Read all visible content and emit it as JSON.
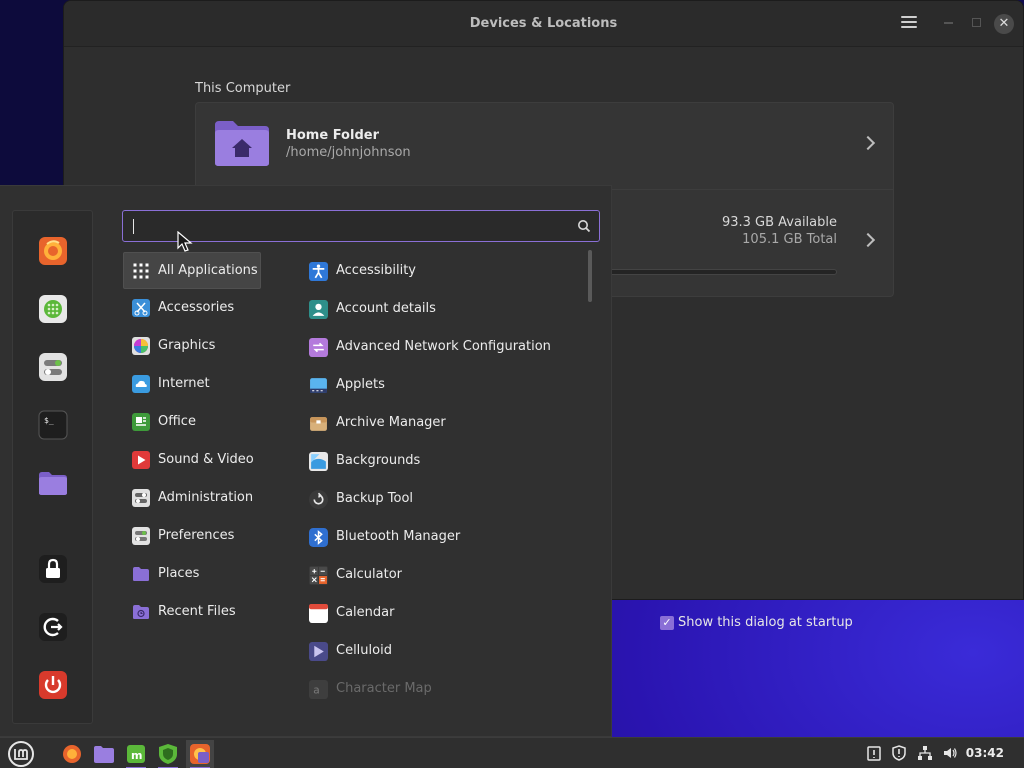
{
  "window": {
    "title": "Devices & Locations",
    "section_title": "This Computer",
    "home": {
      "name": "Home Folder",
      "path": "/home/johnjohnson"
    },
    "disk": {
      "available": "93.3 GB Available",
      "total": "105.1 GB Total"
    },
    "startup_checkbox": {
      "label": "Show this dialog at startup",
      "checked": true
    }
  },
  "menu": {
    "search": {
      "value": "",
      "placeholder": ""
    },
    "favorites": [
      {
        "name": "firefox-icon"
      },
      {
        "name": "software-manager-icon"
      },
      {
        "name": "settings-icon"
      },
      {
        "name": "terminal-icon"
      },
      {
        "name": "files-icon"
      },
      {
        "name": "lock-icon"
      },
      {
        "name": "logout-icon"
      },
      {
        "name": "power-icon"
      }
    ],
    "categories": [
      {
        "label": "All Applications",
        "icon": "grid-icon",
        "color": "#ffffff"
      },
      {
        "label": "Accessories",
        "icon": "scissors-icon",
        "color": "#3a8fd8"
      },
      {
        "label": "Graphics",
        "icon": "color-wheel-icon",
        "color": "#c43bd6"
      },
      {
        "label": "Internet",
        "icon": "cloud-icon",
        "color": "#3a9be0"
      },
      {
        "label": "Office",
        "icon": "document-icon",
        "color": "#3e9a3a"
      },
      {
        "label": "Sound & Video",
        "icon": "play-icon",
        "color": "#e03a3a"
      },
      {
        "label": "Administration",
        "icon": "toggles-icon",
        "color": "#cfcfcf"
      },
      {
        "label": "Preferences",
        "icon": "settings-icon",
        "color": "#d8d8d8"
      },
      {
        "label": "Places",
        "icon": "folder-icon",
        "color": "#8a6fd6"
      },
      {
        "label": "Recent Files",
        "icon": "recent-folder-icon",
        "color": "#8a6fd6"
      }
    ],
    "apps": [
      {
        "label": "Accessibility",
        "icon": "accessibility-icon",
        "color": "#2f78d8"
      },
      {
        "label": "Account details",
        "icon": "account-icon",
        "color": "#2e8f8a"
      },
      {
        "label": "Advanced Network Configuration",
        "icon": "network-icon",
        "color": "#b47adc"
      },
      {
        "label": "Applets",
        "icon": "applets-icon",
        "color": "#5ab4ef"
      },
      {
        "label": "Archive Manager",
        "icon": "archive-icon",
        "color": "#d8b07a"
      },
      {
        "label": "Backgrounds",
        "icon": "backgrounds-icon",
        "color": "#3a9be0"
      },
      {
        "label": "Backup Tool",
        "icon": "backup-icon",
        "color": "#3a3a3a"
      },
      {
        "label": "Bluetooth Manager",
        "icon": "bluetooth-icon",
        "color": "#2f6fd0"
      },
      {
        "label": "Calculator",
        "icon": "calculator-icon",
        "color": "#5a5a5a"
      },
      {
        "label": "Calendar",
        "icon": "calendar-icon",
        "color": "#e04a3a"
      },
      {
        "label": "Celluloid",
        "icon": "celluloid-icon",
        "color": "#4a4a8a"
      },
      {
        "label": "Character Map",
        "icon": "charmap-icon",
        "color": "#5a5a5a"
      }
    ]
  },
  "taskbar": {
    "items": [
      {
        "name": "menu-button"
      },
      {
        "name": "firefox-launcher"
      },
      {
        "name": "files-launcher"
      },
      {
        "name": "mintinstall-launcher"
      },
      {
        "name": "mintupdate-launcher"
      },
      {
        "name": "active-window-button"
      }
    ],
    "clock": "03:42"
  },
  "colors": {
    "accent": "#8a6fd6",
    "panel": "#303030"
  }
}
